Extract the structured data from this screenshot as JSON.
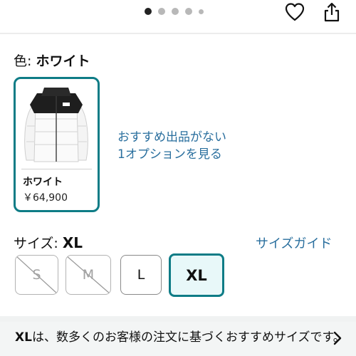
{
  "gallery": {
    "page_count": 5,
    "active_index": 0
  },
  "icons": {
    "favorite": "heart-outline-icon",
    "share": "share-icon",
    "chevron": "chevron-right-icon"
  },
  "color": {
    "label": "色: ",
    "value": "ホワイト"
  },
  "swatch": {
    "name": "ホワイト",
    "price": "￥64,900",
    "image": "white-puffer-jacket"
  },
  "offer_link": {
    "line1": "おすすめ出品がない",
    "line2": "1オプションを見る"
  },
  "size": {
    "label": "サイズ: ",
    "value": "XL",
    "guide": "サイズガイド",
    "options": [
      {
        "label": "S",
        "available": false
      },
      {
        "label": "M",
        "available": false
      },
      {
        "label": "L",
        "available": true
      },
      {
        "label": "XL",
        "available": true,
        "selected": true
      }
    ]
  },
  "banner": {
    "bold": "XL",
    "text": "は、数多くのお客様の注文に基づくおすすめサイズです。"
  },
  "colors": {
    "accent": "#0e7c86",
    "link": "#2a6f9e",
    "selected_bg": "#e8f8f9"
  }
}
